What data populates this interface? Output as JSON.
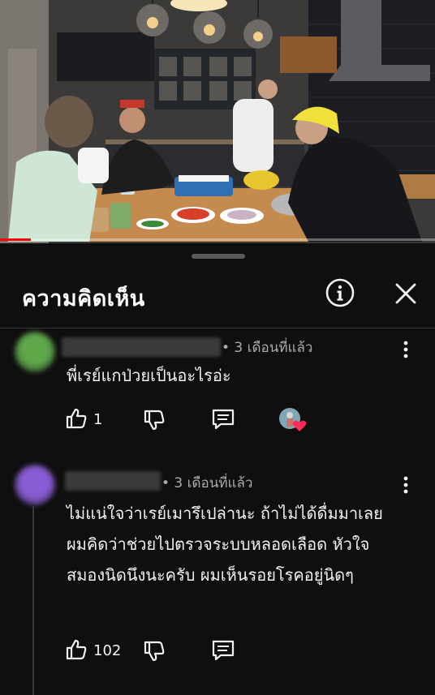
{
  "video": {
    "progress_fraction": 0.07
  },
  "panel": {
    "title": "ความคิดเห็น",
    "info_icon": "info-circle-icon",
    "close_icon": "close-icon"
  },
  "comments": [
    {
      "avatar_color": "#5ea84a",
      "time": "• 3 เดือนที่แล้ว",
      "text": "พี่เรย์แกป่วยเป็นอะไรอ่ะ",
      "likes": "1",
      "creator_heart": true
    },
    {
      "avatar_color": "#8a5cd6",
      "time": "• 3 เดือนที่แล้ว",
      "text": "ไม่แน่ใจว่าเรย์เมารึเปล่านะ ถ้าไม่ได้ดื่มมาเลยผมคิดว่าช่วยไปตรวจระบบหลอดเลือด หัวใจ สมองนิดนึงนะครับ ผมเห็นรอยโรคอยู่นิดๆ",
      "likes": "102",
      "creator_heart": false
    }
  ],
  "colors": {
    "background": "#0f0f0f",
    "progress": "#ff0000",
    "heart": "#ff2d55"
  }
}
